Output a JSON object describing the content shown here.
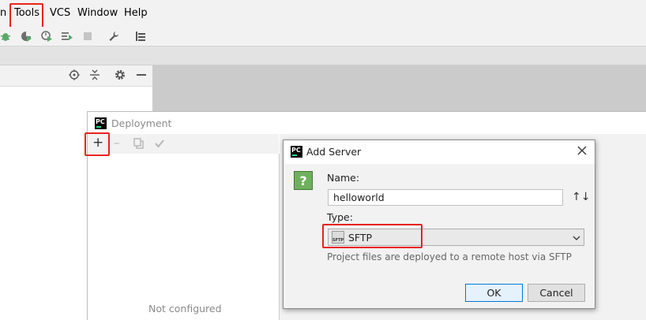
{
  "menubar": {
    "items": [
      "n",
      "Tools",
      "VCS",
      "Window",
      "Help"
    ]
  },
  "toolbar": {
    "icons": [
      "bug-icon",
      "coverage-icon",
      "profile-icon",
      "run-list-icon",
      "stop-icon",
      "wrench-icon",
      "database-icon"
    ]
  },
  "left_panel": {
    "icons": [
      "crosshair-icon",
      "collapse-icon",
      "gear-icon",
      "minimize-icon"
    ]
  },
  "deployment": {
    "title": "Deployment",
    "logo": "PC",
    "toolbar": {
      "add": "+",
      "remove": "–"
    },
    "empty_text": "Not configured"
  },
  "add_server": {
    "title": "Add Server",
    "logo": "PC",
    "help_icon": "?",
    "name_label": "Name:",
    "name_value": "helloworld",
    "sort_icon": "↑↓",
    "type_label": "Type:",
    "type_icon_text": "SFTP",
    "type_value": "SFTP",
    "type_description": "Project files are deployed to a remote host via SFTP",
    "ok_label": "OK",
    "cancel_label": "Cancel"
  },
  "colors": {
    "highlight": "#e8231e",
    "help_icon": "#4a9c3b",
    "logo_accent": "#21d789"
  }
}
